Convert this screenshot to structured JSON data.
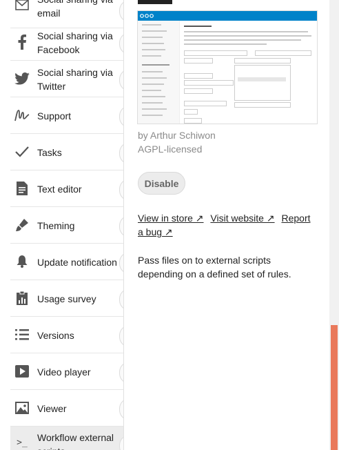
{
  "apps": [
    {
      "label": "Social sharing via email",
      "icon": "mail-icon"
    },
    {
      "label": "Social sharing via Facebook",
      "icon": "facebook-icon"
    },
    {
      "label": "Social sharing via Twitter",
      "icon": "twitter-icon"
    },
    {
      "label": "Support",
      "icon": "support-icon"
    },
    {
      "label": "Tasks",
      "icon": "checkmark-icon"
    },
    {
      "label": "Text editor",
      "icon": "document-icon"
    },
    {
      "label": "Theming",
      "icon": "paintbrush-icon"
    },
    {
      "label": "Update notification",
      "icon": "bell-icon"
    },
    {
      "label": "Usage survey",
      "icon": "clipboard-icon"
    },
    {
      "label": "Versions",
      "icon": "list-icon"
    },
    {
      "label": "Video player",
      "icon": "play-icon"
    },
    {
      "label": "Viewer",
      "icon": "image-icon"
    },
    {
      "label": "Workflow external scripts",
      "icon": "terminal-icon"
    }
  ],
  "details": {
    "author": "by Arthur Schiwon",
    "license": "AGPL-licensed",
    "disable_label": "Disable",
    "view_in_store": "View in store ↗",
    "visit_website": "Visit website ↗",
    "report_bug": "Report a bug ↗",
    "description": "Pass files on to external scripts depending on a defined set of rules."
  },
  "colors": {
    "brand": "#0082c9",
    "scrollbar_thumb": "#e9795b"
  }
}
